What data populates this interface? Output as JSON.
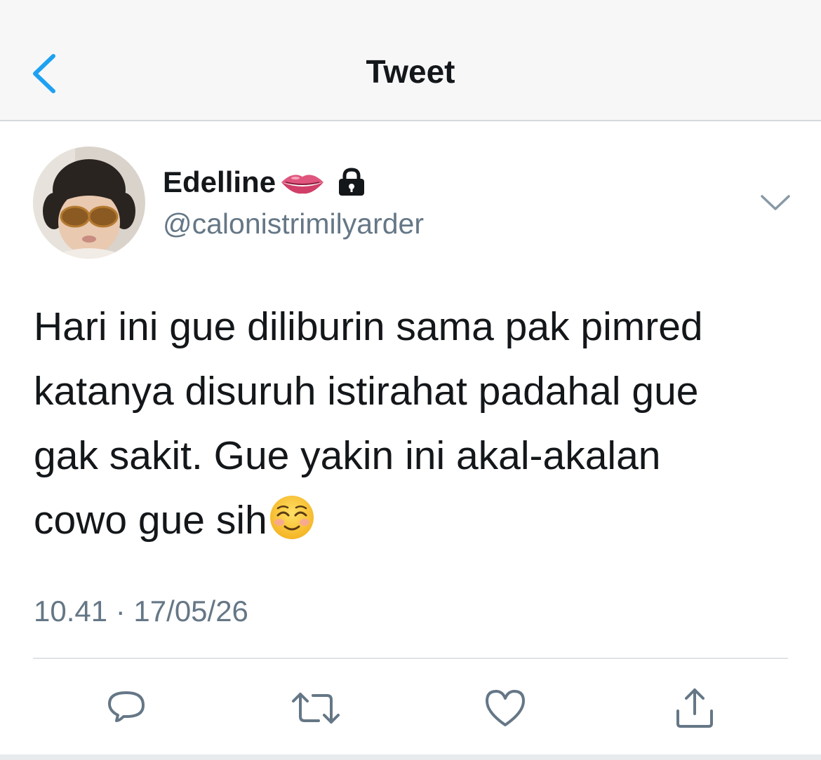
{
  "header": {
    "title": "Tweet",
    "back_icon": "chevron-left-icon"
  },
  "tweet": {
    "author": {
      "display_name": "Edelline",
      "name_emoji": "lips-emoji",
      "protected_icon": "lock-icon",
      "handle": "@calonistrimilyarder"
    },
    "text_lines": [
      "Hari ini gue diliburin sama pak pimred",
      "katanya disuruh istirahat padahal gue",
      "gak sakit. Gue yakin ini akal-akalan",
      "cowo gue sih"
    ],
    "text_emoji": "smiling-face-emoji",
    "timestamp": "10.41 · 17/05/26"
  },
  "actions": [
    "reply-icon",
    "retweet-icon",
    "like-icon",
    "share-icon"
  ],
  "colors": {
    "accent": "#1da1f2",
    "text": "#14171a",
    "secondary": "#657786",
    "header_bg": "#f7f7f8",
    "divider": "#dfe3e6"
  }
}
